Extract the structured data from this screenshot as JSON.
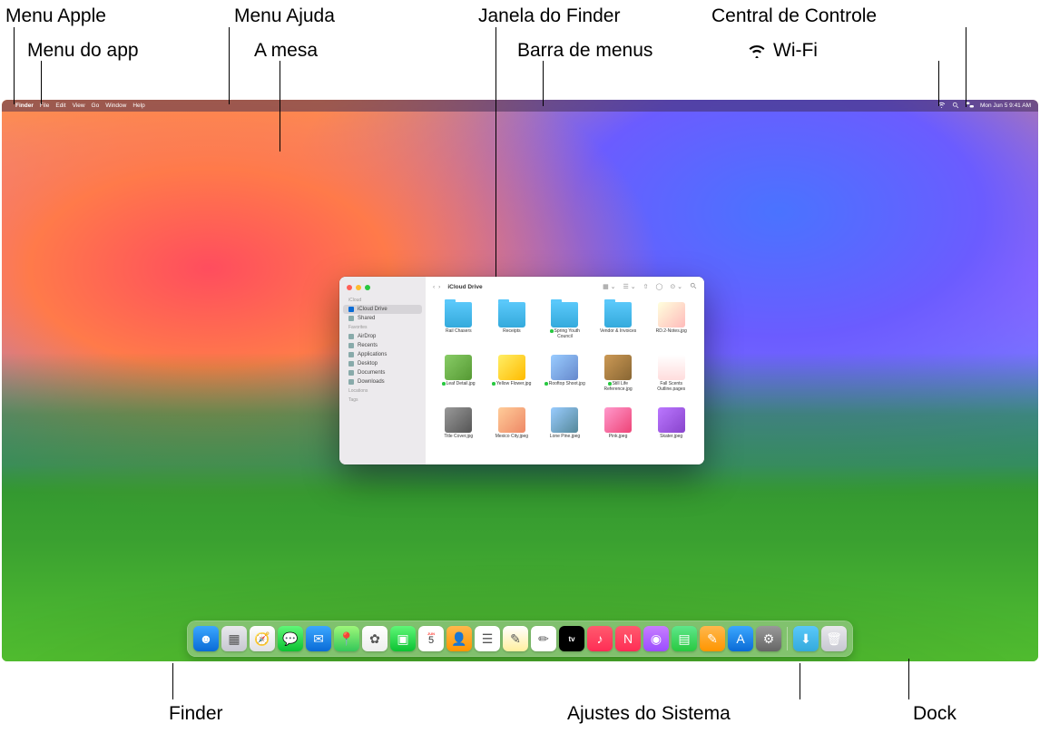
{
  "callouts": {
    "top": {
      "apple_menu": "Menu Apple",
      "app_menu": "Menu do app",
      "help_menu": "Menu Ajuda",
      "desktop": "A mesa",
      "finder_window": "Janela do Finder",
      "menu_bar": "Barra de menus",
      "control_center": "Central de Controle",
      "wifi": "Wi-Fi"
    },
    "bottom": {
      "finder": "Finder",
      "system_settings": "Ajustes do Sistema",
      "dock": "Dock"
    }
  },
  "menubar": {
    "app_name": "Finder",
    "items": [
      "File",
      "Edit",
      "View",
      "Go",
      "Window",
      "Help"
    ],
    "clock": "Mon Jun 5  9:41 AM"
  },
  "finder": {
    "title": "iCloud Drive",
    "sidebar": {
      "sections": [
        {
          "header": "iCloud",
          "items": [
            {
              "label": "iCloud Drive",
              "selected": true
            },
            {
              "label": "Shared",
              "selected": false
            }
          ]
        },
        {
          "header": "Favorites",
          "items": [
            {
              "label": "AirDrop"
            },
            {
              "label": "Recents"
            },
            {
              "label": "Applications"
            },
            {
              "label": "Desktop"
            },
            {
              "label": "Documents"
            },
            {
              "label": "Downloads"
            }
          ]
        },
        {
          "header": "Locations",
          "items": []
        },
        {
          "header": "Tags",
          "items": []
        }
      ]
    },
    "files": [
      {
        "name": "Rail Chasers",
        "type": "folder"
      },
      {
        "name": "Receipts",
        "type": "folder"
      },
      {
        "name": "Spring Youth Council",
        "type": "folder",
        "dot": true
      },
      {
        "name": "Vendor & Invoices",
        "type": "folder"
      },
      {
        "name": "RD.2-Notes.jpg",
        "type": "pic",
        "bg": "linear-gradient(135deg,#ffd,#fbb)"
      },
      {
        "name": "Leaf Detail.jpg",
        "type": "pic",
        "dot": true,
        "bg": "linear-gradient(135deg,#8c6,#593)"
      },
      {
        "name": "Yellow Flower.jpg",
        "type": "pic",
        "dot": true,
        "bg": "linear-gradient(135deg,#fe6,#fb0)"
      },
      {
        "name": "Rooftop Shoot.jpg",
        "type": "pic",
        "dot": true,
        "bg": "linear-gradient(135deg,#9cf,#68c)"
      },
      {
        "name": "Still Life Reference.jpg",
        "type": "pic",
        "dot": true,
        "bg": "linear-gradient(135deg,#c95,#863)"
      },
      {
        "name": "Fall Scents Outline.pages",
        "type": "pic",
        "bg": "linear-gradient(180deg,#fff,#fdd)"
      },
      {
        "name": "Title Cover.jpg",
        "type": "pic",
        "bg": "linear-gradient(135deg,#999,#555)"
      },
      {
        "name": "Mexico City.jpeg",
        "type": "pic",
        "bg": "linear-gradient(135deg,#fc9,#e86)"
      },
      {
        "name": "Lone Pine.jpeg",
        "type": "pic",
        "bg": "linear-gradient(135deg,#9cf,#589)"
      },
      {
        "name": "Pink.jpeg",
        "type": "pic",
        "bg": "linear-gradient(135deg,#f9c,#e47)"
      },
      {
        "name": "Skater.jpeg",
        "type": "pic",
        "bg": "linear-gradient(135deg,#b7f,#84c)"
      }
    ]
  },
  "calendar_icon": {
    "month": "JUN",
    "day": "5"
  },
  "dock_icons": [
    "finder",
    "launchpad",
    "safari",
    "messages",
    "mail",
    "maps",
    "photos",
    "facetime",
    "calendar",
    "contacts",
    "reminders",
    "notes",
    "freeform",
    "tv",
    "music",
    "news",
    "podcasts",
    "numbers",
    "pages",
    "appstore",
    "settings"
  ],
  "dock_right": [
    "downloads",
    "trash"
  ]
}
